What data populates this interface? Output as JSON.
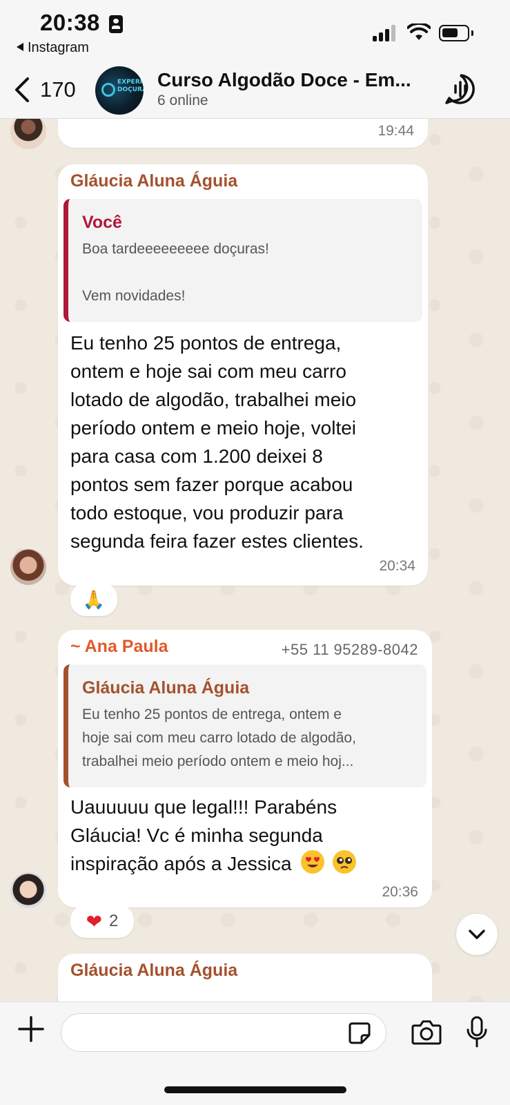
{
  "status_bar": {
    "time": "20:38",
    "back_app": "Instagram"
  },
  "header": {
    "back_count": "170",
    "title": "Curso Algodão Doce - Em...",
    "subtitle": "6 online",
    "avatar_text": "EXPERIÊNCIA DOÇURA"
  },
  "messages": [
    {
      "time": "19:44"
    },
    {
      "sender": "Gláucia Aluna Águia",
      "quote": {
        "author": "Você",
        "lines": [
          "Boa tardeeeeeeeee doçuras!",
          "",
          "Vem novidades!"
        ]
      },
      "lines": [
        "Eu tenho 25 pontos de entrega,",
        "ontem e  hoje sai com meu carro",
        "lotado de algodão, trabalhei meio",
        "período ontem e meio hoje, voltei",
        "para casa com 1.200 deixei 8",
        "pontos sem fazer porque acabou",
        "todo estoque,  vou produzir para",
        "segunda feira  fazer estes clientes."
      ],
      "time": "20:34",
      "reaction": "🙏"
    },
    {
      "sender": "~ Ana Paula",
      "phone": "+55 11 95289-8042",
      "quote": {
        "author": "Gláucia Aluna Águia",
        "lines": [
          "Eu tenho 25 pontos de entrega, ontem e",
          "hoje sai com meu carro lotado de algodão,",
          "trabalhei meio período ontem e meio hoj..."
        ]
      },
      "lines": [
        "Uauuuuu que legal!!! Parabéns",
        "Gláucia! Vc é minha segunda",
        "inspiração após a Jessica"
      ],
      "emojis": [
        "heart-eyes-emoji",
        "pleading-face-emoji"
      ],
      "time": "20:36",
      "reaction": {
        "emoji": "❤",
        "count": "2"
      }
    },
    {
      "sender": "Gláucia Aluna Águia"
    }
  ],
  "input": {
    "placeholder": ""
  },
  "colors": {
    "you_quote": "#b0173a",
    "sender": "#a4512d",
    "ana_paula": "#e05a2b"
  }
}
